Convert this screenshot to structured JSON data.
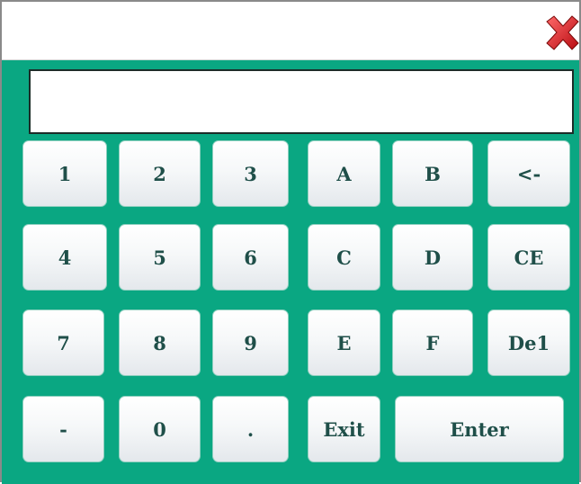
{
  "titlebar": {
    "close_icon": "close-x-icon",
    "close_color": "#d0161c"
  },
  "display": {
    "value": ""
  },
  "colors": {
    "panel": "#0aa782",
    "key_text": "#1f4f49"
  },
  "keys": {
    "k1": "1",
    "k2": "2",
    "k3": "3",
    "kA": "A",
    "kB": "B",
    "backspace": "<-",
    "k4": "4",
    "k5": "5",
    "k6": "6",
    "kC": "C",
    "kD": "D",
    "ce": "CE",
    "k7": "7",
    "k8": "8",
    "k9": "9",
    "kE": "E",
    "kF": "F",
    "del": "De1",
    "minus": "-",
    "k0": "0",
    "dot": ".",
    "exit": "Exit",
    "enter": "Enter"
  }
}
